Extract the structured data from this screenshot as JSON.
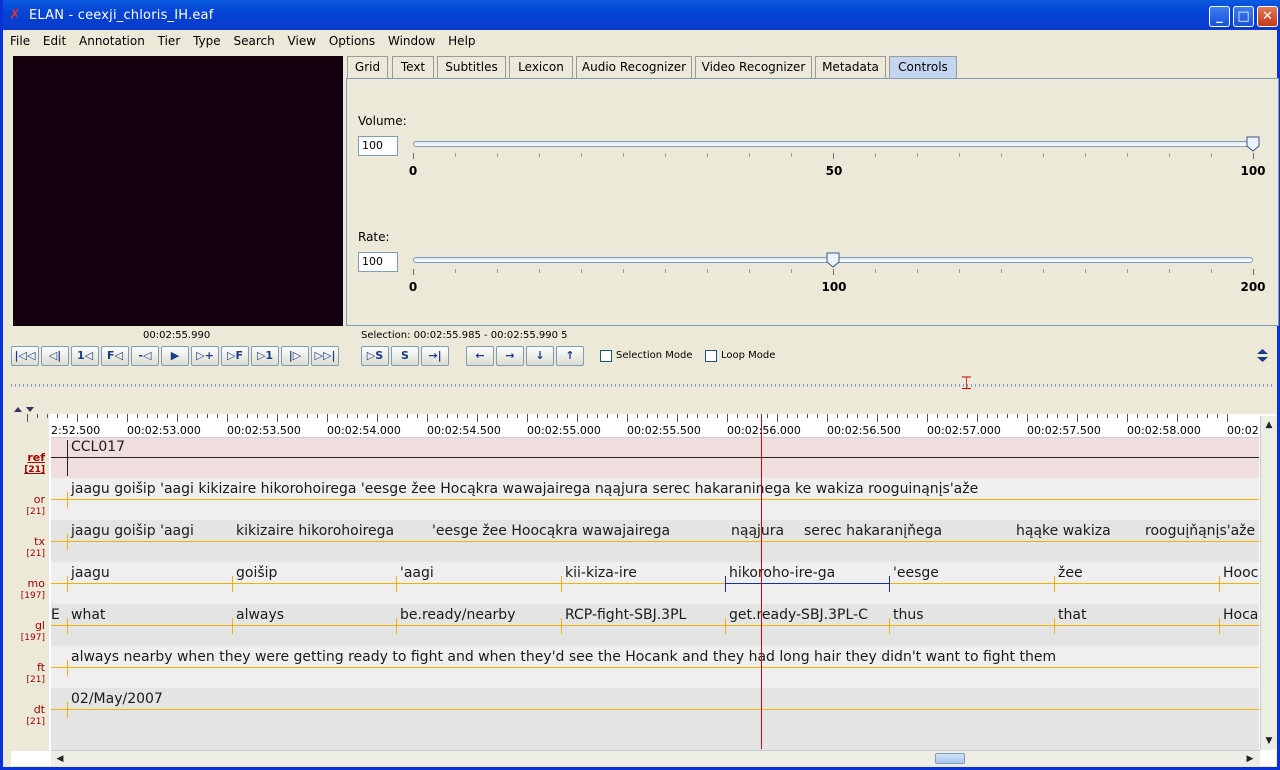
{
  "window": {
    "title": "ELAN - ceexji_chloris_IH.eaf",
    "minimize_icon": "minimize-icon",
    "maximize_icon": "maximize-icon",
    "close_icon": "close-icon"
  },
  "menu": [
    "File",
    "Edit",
    "Annotation",
    "Tier",
    "Type",
    "Search",
    "View",
    "Options",
    "Window",
    "Help"
  ],
  "tabs": [
    "Grid",
    "Text",
    "Subtitles",
    "Lexicon",
    "Audio Recognizer",
    "Video Recognizer",
    "Metadata",
    "Controls"
  ],
  "active_tab": "Controls",
  "controls": {
    "volume": {
      "label": "Volume:",
      "value": "100",
      "level": 100,
      "min": 0,
      "max": 100,
      "ticks": [
        "0",
        "50",
        "100"
      ]
    },
    "rate": {
      "label": "Rate:",
      "value": "100",
      "level": 100,
      "min": 0,
      "max": 200,
      "ticks": [
        "0",
        "100",
        "200"
      ]
    }
  },
  "media": {
    "timecode": "00:02:55.990",
    "selection": "Selection: 00:02:55.985 - 00:02:55.990  5",
    "selection_mode": "Selection Mode",
    "loop_mode": "Loop Mode",
    "player_buttons": [
      "|◁◁",
      "◁|",
      "1◁",
      "F◁",
      "-◁",
      "▶",
      "▷+",
      "▷F",
      "▷1",
      "|▷",
      "▷▷|"
    ],
    "selection_buttons": [
      "▷S",
      "S",
      "→|"
    ],
    "nav_buttons": [
      "←",
      "→",
      "↓",
      "↑"
    ]
  },
  "ruler": [
    "2:52.500",
    "00:02:53.000",
    "00:02:53.500",
    "00:02:54.000",
    "00:02:54.500",
    "00:02:55.000",
    "00:02:55.500",
    "00:02:56.000",
    "00:02:56.500",
    "00:02:57.000",
    "00:02:57.500",
    "00:02:58.000",
    "00:02"
  ],
  "tiers": [
    {
      "name": "ref",
      "count": "[21]",
      "annotations": [
        "CCL017"
      ]
    },
    {
      "name": "or",
      "count": "[21]",
      "annotations": [
        "jaagu goišip 'aagi kikizaire hikorohoirega 'eesge žee Hocąkra wawajairega nąąjura serec hakaraninega ke wakiza rooguinąnįs'aže"
      ]
    },
    {
      "name": "tx",
      "count": "[21]",
      "annotations": [
        "jaagu goišip 'aagi",
        "kikizaire hikorohoirega",
        "'eesge žee Hoocąkra wawajairega",
        "nąąjura",
        "serec hakaranįňega",
        "hąąke wakiza",
        "rooguįňąnįs'aže"
      ]
    },
    {
      "name": "mo",
      "count": "[197]",
      "annotations": [
        "jaagu",
        "goišip",
        "'aagi",
        "kii-kiza-ire",
        "hikoroho-ire-ga",
        "'eesge",
        "žee",
        "Hoocąk"
      ]
    },
    {
      "name": "gl",
      "count": "[197]",
      "annotations": [
        "E",
        "what",
        "always",
        "be.ready/nearby",
        "RCP-fight-SBJ.3PL",
        "get.ready-SBJ.3PL-C",
        "thus",
        "that",
        "Hoca"
      ]
    },
    {
      "name": "ft",
      "count": "[21]",
      "annotations": [
        "always nearby when they were getting ready to fight and when they'd see the Hocank and they had long hair they didn't want to fight them"
      ]
    },
    {
      "name": "dt",
      "count": "[21]",
      "annotations": [
        "02/May/2007"
      ]
    }
  ]
}
